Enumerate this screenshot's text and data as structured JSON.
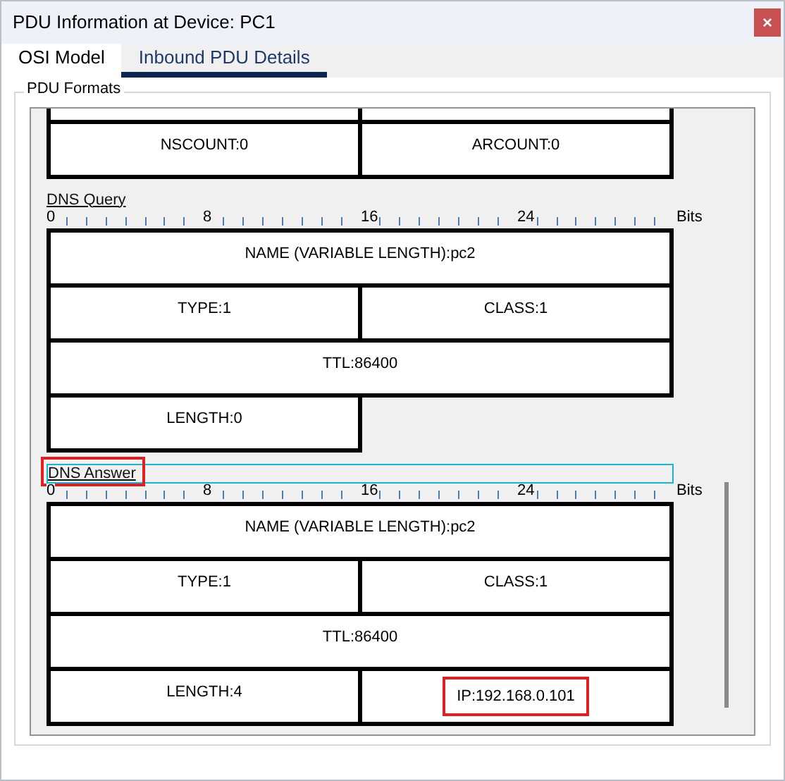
{
  "window": {
    "title": "PDU Information at Device: PC1",
    "close": "×"
  },
  "tabs": [
    {
      "label": "OSI Model",
      "selected": false
    },
    {
      "label": "Inbound PDU Details",
      "selected": true
    }
  ],
  "group": {
    "title": "PDU Formats"
  },
  "sections": [
    {
      "cut_top": true,
      "rows": [
        [
          {
            "kind": "half"
          },
          {
            "kind": "half"
          }
        ],
        [
          {
            "kind": "half",
            "text": "NSCOUNT:0"
          },
          {
            "kind": "half",
            "text": "ARCOUNT:0"
          }
        ]
      ]
    },
    {
      "title": "DNS Query",
      "highlighted": false,
      "annotated": false,
      "ruler": {
        "labels": [
          "0",
          "8",
          "16",
          "24"
        ],
        "unit": "Bits"
      },
      "rows": [
        [
          {
            "kind": "full",
            "text": "NAME (VARIABLE LENGTH):pc2"
          }
        ],
        [
          {
            "kind": "half",
            "text": "TYPE:1"
          },
          {
            "kind": "half",
            "text": "CLASS:1"
          }
        ],
        [
          {
            "kind": "full",
            "text": "TTL:86400"
          }
        ],
        [
          {
            "kind": "half",
            "text": "LENGTH:0"
          }
        ]
      ]
    },
    {
      "title": "DNS Answer",
      "highlighted": true,
      "annotated": true,
      "ruler": {
        "labels": [
          "0",
          "8",
          "16",
          "24"
        ],
        "unit": "Bits"
      },
      "rows": [
        [
          {
            "kind": "full",
            "text": "NAME (VARIABLE LENGTH):pc2"
          }
        ],
        [
          {
            "kind": "half",
            "text": "TYPE:1"
          },
          {
            "kind": "half",
            "text": "CLASS:1"
          }
        ],
        [
          {
            "kind": "full",
            "text": "TTL:86400"
          }
        ],
        [
          {
            "kind": "half",
            "text": "LENGTH:4"
          },
          {
            "kind": "half",
            "text": "IP:192.168.0.101",
            "annotated": true
          }
        ]
      ]
    }
  ]
}
